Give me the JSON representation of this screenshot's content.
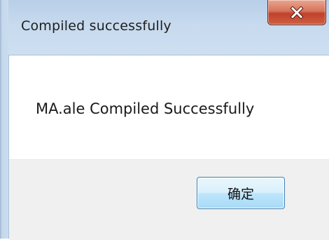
{
  "window": {
    "title": "Compiled successfully"
  },
  "titlebar": {
    "close_icon": "close-x-icon"
  },
  "dialog": {
    "message": "MA.ale Compiled Successfully",
    "ok_label": "确定"
  },
  "colors": {
    "frame": "#c3d6ea",
    "close_button": "#c7432c",
    "ok_button_border": "#3c7fb1",
    "footer_bg": "#f0f0f0"
  }
}
